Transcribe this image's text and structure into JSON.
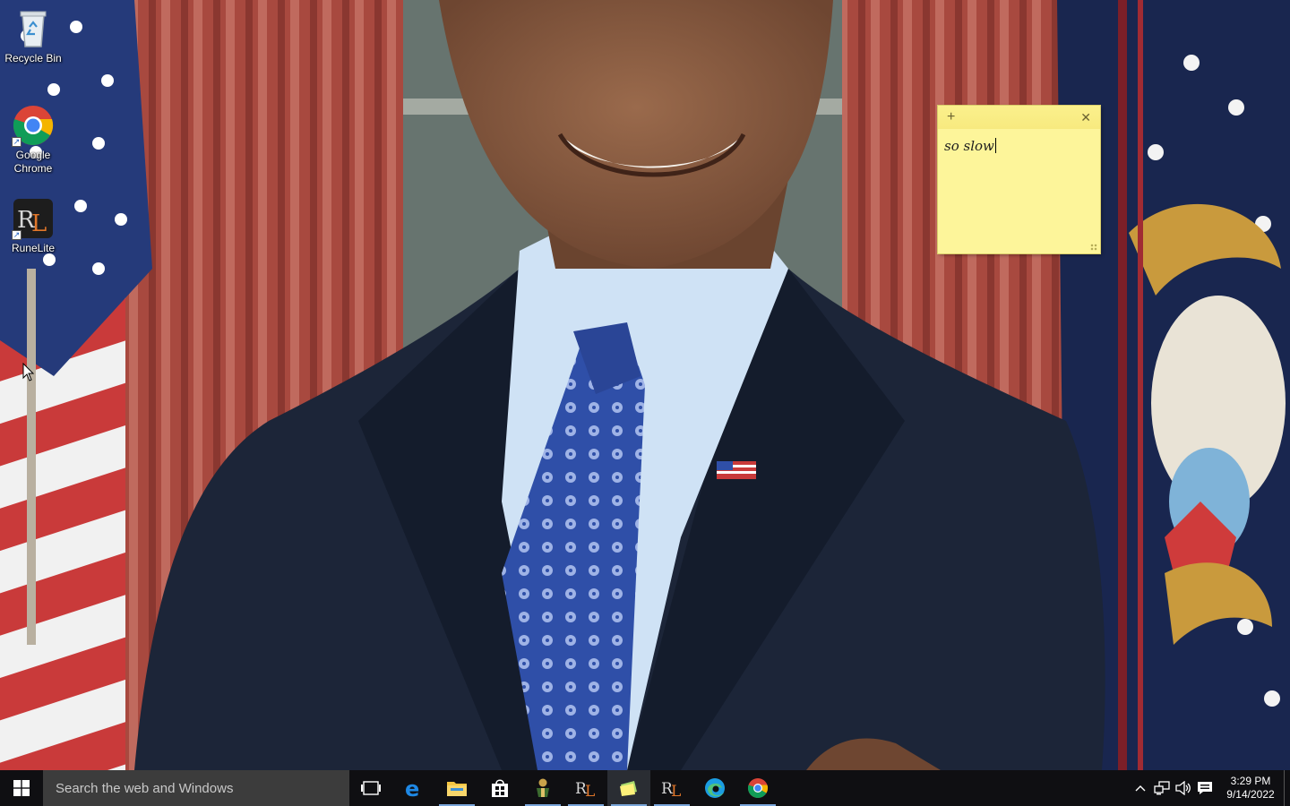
{
  "desktop": {
    "icons": [
      {
        "label": "Recycle Bin"
      },
      {
        "label": "Google\nChrome"
      },
      {
        "label": "RuneLite"
      }
    ]
  },
  "sticky_note": {
    "add_glyph": "+",
    "close_glyph": "✕",
    "text": "so slow"
  },
  "taskbar": {
    "search": {
      "placeholder": "Search the web and Windows",
      "value": ""
    },
    "apps": [
      {
        "icon": "task-view-icon"
      },
      {
        "icon": "edge-legacy-icon"
      },
      {
        "icon": "file-explorer-icon"
      },
      {
        "icon": "store-icon"
      },
      {
        "icon": "game-character-icon"
      },
      {
        "icon": "runelite-icon"
      },
      {
        "icon": "sticky-notes-icon"
      },
      {
        "icon": "runelite-icon"
      },
      {
        "icon": "edge-icon"
      },
      {
        "icon": "chrome-icon"
      }
    ],
    "tray": {
      "chevron": "^",
      "time": "3:29 PM",
      "date": "9/14/2022"
    }
  },
  "colors": {
    "taskbar_bg": "#0f0f12",
    "search_bg": "#3c3c3c",
    "sticky_bg": "#fdf59a",
    "running_indicator": "#7aa6da"
  }
}
